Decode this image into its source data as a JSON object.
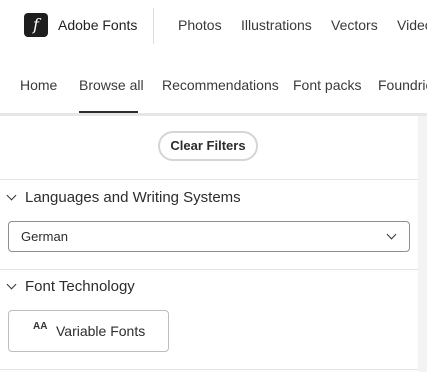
{
  "header": {
    "logo_glyph": "f",
    "brand": "Adobe Fonts",
    "nav": [
      "Photos",
      "Illustrations",
      "Vectors",
      "Video"
    ]
  },
  "subnav": {
    "items": [
      "Home",
      "Browse all",
      "Recommendations",
      "Font packs",
      "Foundries"
    ],
    "active": "Browse all"
  },
  "filters": {
    "clear_label": "Clear Filters",
    "languages": {
      "heading": "Languages and Writing Systems",
      "selected": "German"
    },
    "technology": {
      "heading": "Font Technology",
      "variable_label": "Variable Fonts",
      "variable_icon": "AA"
    }
  }
}
